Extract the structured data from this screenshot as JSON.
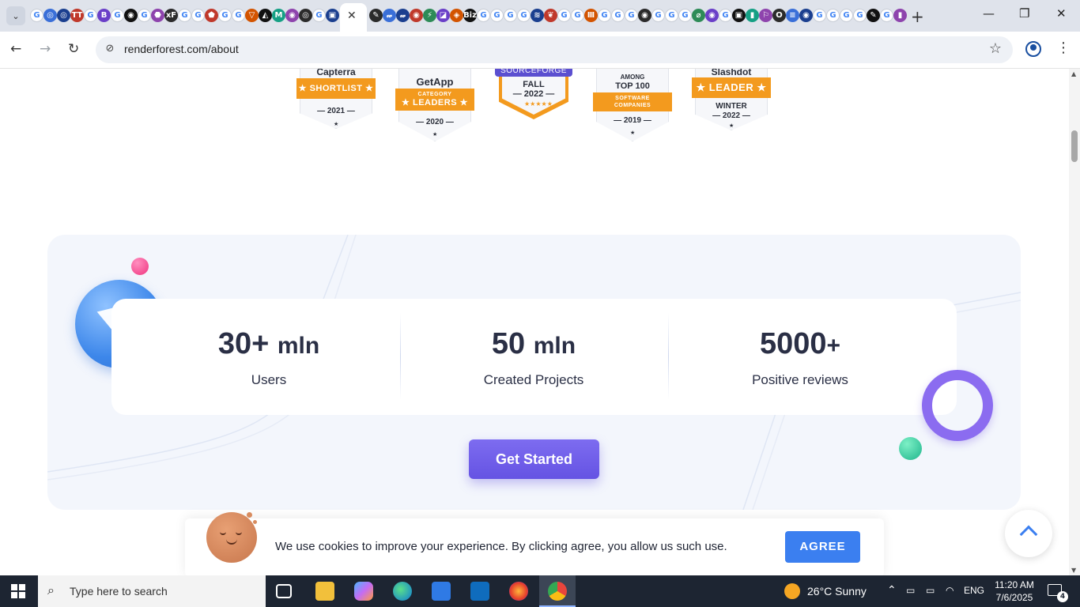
{
  "browser": {
    "tab_favicons": [
      "G",
      "◎",
      "◎",
      "TT",
      "G",
      "B",
      "G",
      "◉",
      "G",
      "⬣",
      "xF",
      "G",
      "G",
      "⬟",
      "G",
      "G",
      "▽",
      "◭",
      "M",
      "◉",
      "◎",
      "G",
      "▣"
    ],
    "tab_favicons_right": [
      "✎",
      "𝓌",
      "𝓌",
      "◉",
      "⚡",
      "◪",
      "◈",
      "Biz",
      "G",
      "G",
      "G",
      "G",
      "≋",
      "❦",
      "G",
      "G",
      "Ⅲ",
      "G",
      "G",
      "G",
      "◉",
      "G",
      "G",
      "G",
      "⌀",
      "◉",
      "G",
      "▣",
      "▮",
      "⚐",
      "O",
      "≡",
      "◉",
      "G",
      "G",
      "G",
      "G",
      "✎",
      "G",
      "▮"
    ],
    "active_tab_close": "✕",
    "new_tab": "+",
    "window_controls": {
      "minimize": "—",
      "restore": "❐",
      "close": "✕"
    },
    "url": "renderforest.com/about",
    "back": "←",
    "forward": "→",
    "reload": "↻",
    "star": "☆",
    "menu": "⋮",
    "site_info": "⊘"
  },
  "badges": [
    {
      "name": "Capterra",
      "ribbon": "SHORTLIST",
      "year": "2021"
    },
    {
      "name": "GetApp",
      "ribbon_top": "CATEGORY",
      "ribbon": "LEADERS",
      "year": "2020"
    },
    {
      "name": "SOURCEFORGE",
      "line1": "FALL",
      "line2": "2022"
    },
    {
      "name": "AMONG",
      "line1": "TOP 100",
      "ribbon_top": "SOFTWARE",
      "ribbon": "COMPANIES",
      "year": "2019"
    },
    {
      "name": "Slashdot",
      "ribbon": "LEADER",
      "line1": "WINTER",
      "line2": "2022"
    }
  ],
  "stats": [
    {
      "number": "30+",
      "unit": "mln",
      "label": "Users"
    },
    {
      "number": "50",
      "unit": "mln",
      "label": "Created Projects"
    },
    {
      "number": "5000",
      "unit": "+",
      "label": "Positive reviews"
    }
  ],
  "cta": {
    "label": "Get Started"
  },
  "cookie": {
    "text": "We use cookies to improve your experience. By clicking agree, you allow us such use.",
    "agree": "AGREE"
  },
  "taskbar": {
    "search_placeholder": "Type here to search",
    "weather": "26°C  Sunny",
    "lang": "ENG",
    "time": "11:20 AM",
    "date": "7/6/2025",
    "notifications": "4",
    "tray_caret": "⌃"
  },
  "colors": {
    "accent_purple": "#6553e3",
    "agree_blue": "#3b7ff0",
    "badge_orange": "#f39a1e",
    "sourceforge_purple": "#5b4fd0"
  }
}
